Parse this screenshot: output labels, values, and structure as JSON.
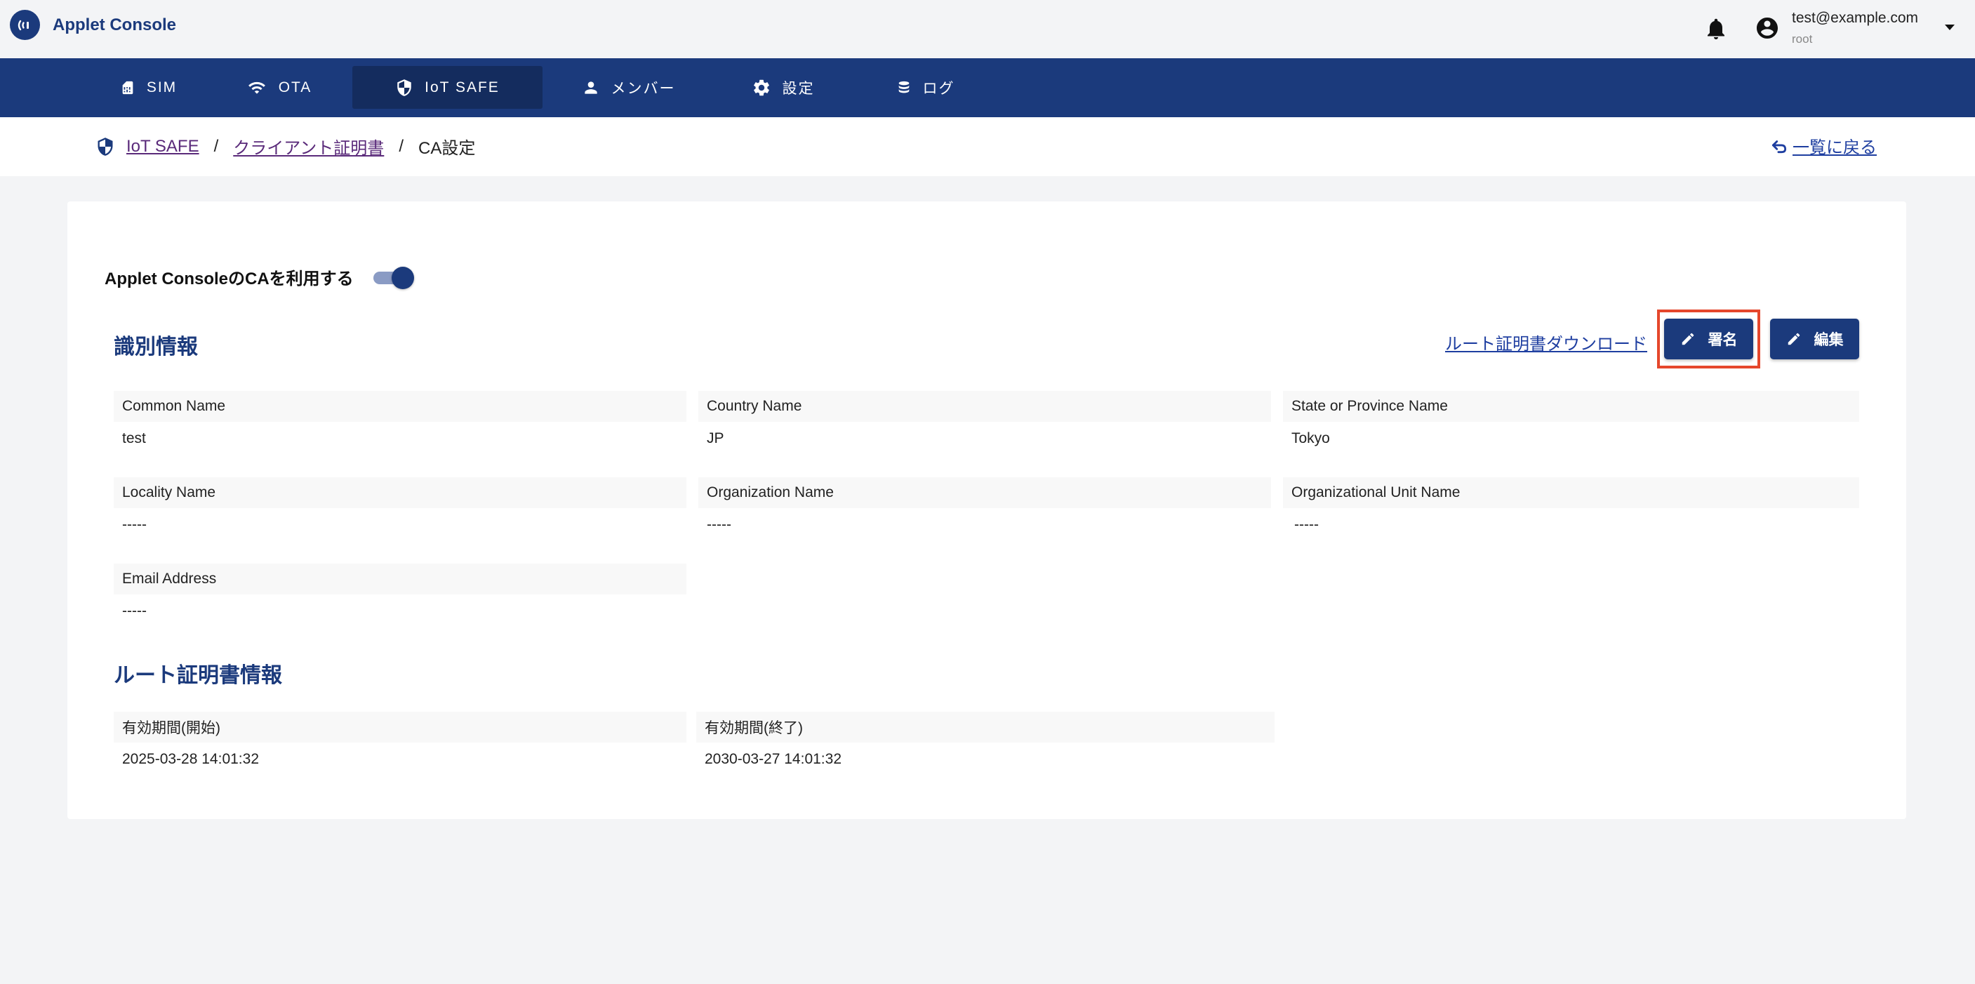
{
  "header": {
    "app_title": "Applet Console",
    "user_email": "test@example.com",
    "user_role": "root"
  },
  "nav": {
    "items": [
      {
        "label": "SIM",
        "icon": "sim-card-icon"
      },
      {
        "label": "OTA",
        "icon": "wifi-icon"
      },
      {
        "label": "IoT SAFE",
        "icon": "shield-icon",
        "active": true
      },
      {
        "label": "メンバー",
        "icon": "person-icon"
      },
      {
        "label": "設定",
        "icon": "gear-icon"
      },
      {
        "label": "ログ",
        "icon": "database-icon"
      }
    ]
  },
  "breadcrumb": {
    "items": [
      "IoT SAFE",
      "クライアント証明書",
      "CA設定"
    ],
    "separator": "/",
    "back_label": "一覧に戻る"
  },
  "ca_toggle": {
    "label": "Applet ConsoleのCAを利用する",
    "enabled": true
  },
  "identity": {
    "title": "識別情報",
    "download_label": "ルート証明書ダウンロード",
    "sign_label": "署名",
    "edit_label": "編集",
    "fields": [
      {
        "label": "Common Name",
        "value": "test"
      },
      {
        "label": "Country Name",
        "value": "JP"
      },
      {
        "label": "State or Province Name",
        "value": "Tokyo"
      },
      {
        "label": "Locality Name",
        "value": "-----"
      },
      {
        "label": "Organization Name",
        "value": "-----"
      },
      {
        "label": "Organizational Unit Name",
        "value": "-----"
      },
      {
        "label": "Email Address",
        "value": "-----"
      }
    ]
  },
  "root_cert": {
    "title": "ルート証明書情報",
    "fields": [
      {
        "label": "有効期間(開始)",
        "value": "2025-03-28 14:01:32"
      },
      {
        "label": "有効期間(終了)",
        "value": "2030-03-27 14:01:32"
      }
    ]
  },
  "colors": {
    "primary": "#1b3a7c",
    "nav_active": "#142c5e",
    "link": "#1e3ea0",
    "highlight": "#e5472c"
  }
}
